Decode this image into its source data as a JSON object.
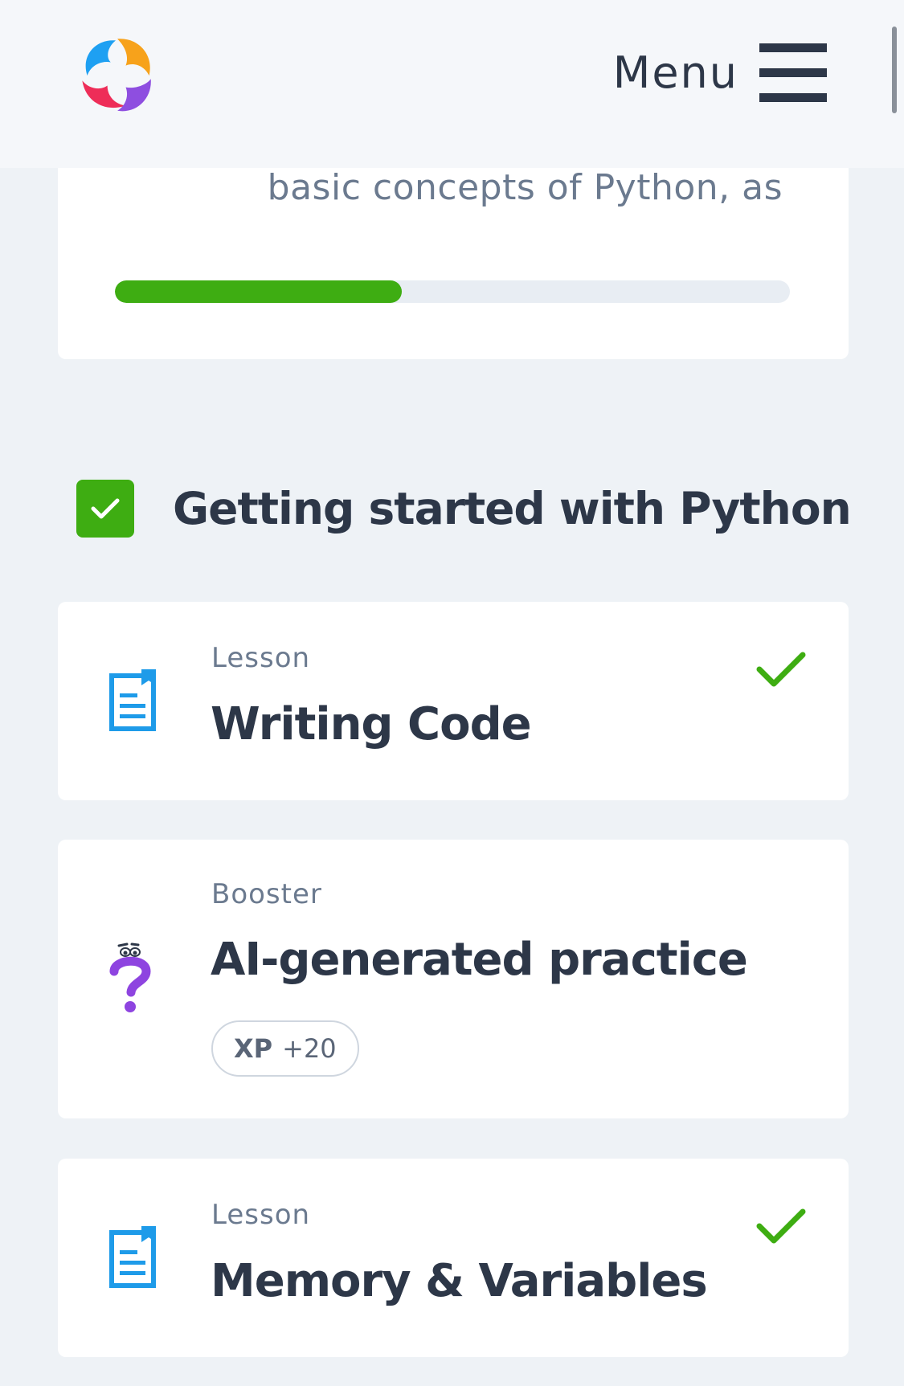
{
  "header": {
    "menu_label": "Menu",
    "logo_icon": "solearn-logo-icon",
    "menu_icon": "hamburger-icon"
  },
  "intro": {
    "text": "basic concepts of Python, as",
    "progress_fraction": 0.425
  },
  "section": {
    "title": "Getting started with Python",
    "completed": true,
    "expanded": true
  },
  "items": [
    {
      "type": "Lesson",
      "title": "Writing Code",
      "icon": "document-icon",
      "completed": true
    },
    {
      "type": "Booster",
      "title": "AI-generated practice",
      "icon": "question-character-icon",
      "completed": false,
      "xp_label": "XP",
      "xp_value": "+20"
    },
    {
      "type": "Lesson",
      "title": "Memory & Variables",
      "icon": "document-icon",
      "completed": true
    }
  ],
  "colors": {
    "accent_green": "#3ead12",
    "lesson_blue": "#1e9be9",
    "booster_purple": "#8e44e0",
    "text_dark": "#2d3748",
    "text_muted": "#6b7a8f",
    "background": "#eef2f6"
  }
}
